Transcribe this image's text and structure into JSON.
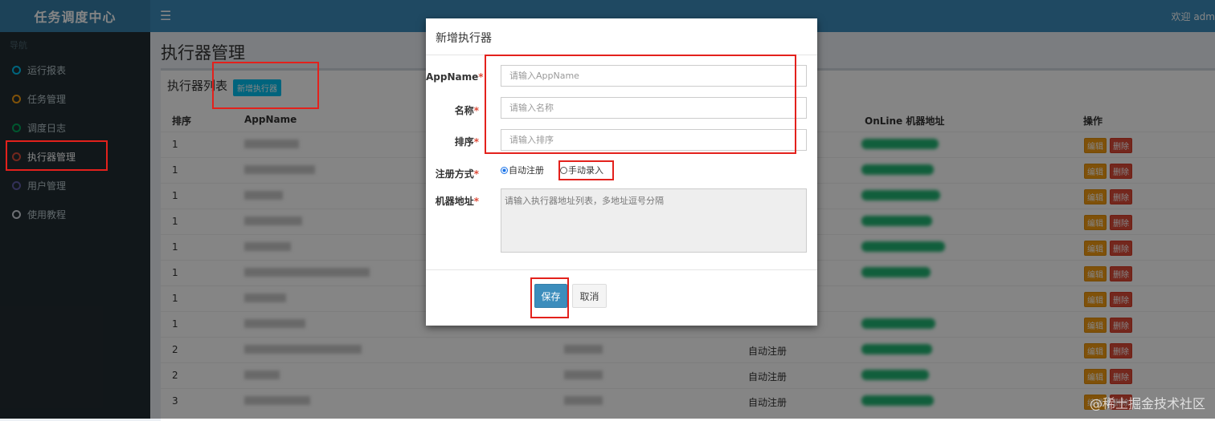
{
  "app": {
    "logo": "任务调度中心",
    "welcome": "欢迎 adm"
  },
  "sidebar": {
    "header": "导航",
    "items": [
      {
        "label": "运行报表",
        "color": "#00c0ef"
      },
      {
        "label": "任务管理",
        "color": "#f39c12"
      },
      {
        "label": "调度日志",
        "color": "#00a65a"
      },
      {
        "label": "执行器管理",
        "color": "#dd4b39"
      },
      {
        "label": "用户管理",
        "color": "#605ca8"
      },
      {
        "label": "使用教程",
        "color": "#d2d6de"
      }
    ]
  },
  "page": {
    "title": "执行器管理"
  },
  "box": {
    "title": "执行器列表",
    "add_button": "新增执行器",
    "columns": [
      "排序",
      "AppName",
      "OnLine 机器地址",
      "操作"
    ],
    "edit_label": "编辑",
    "delete_label": "删除",
    "rows": [
      {
        "order": "1",
        "reg": ""
      },
      {
        "order": "1",
        "reg": ""
      },
      {
        "order": "1",
        "reg": ""
      },
      {
        "order": "1",
        "reg": ""
      },
      {
        "order": "1",
        "reg": ""
      },
      {
        "order": "1",
        "reg": ""
      },
      {
        "order": "1",
        "reg": ""
      },
      {
        "order": "1",
        "reg": ""
      },
      {
        "order": "2",
        "reg": "自动注册"
      },
      {
        "order": "2",
        "reg": "自动注册"
      },
      {
        "order": "3",
        "reg": "自动注册"
      }
    ]
  },
  "modal": {
    "title": "新增执行器",
    "fields": {
      "appname": {
        "label": "AppName",
        "placeholder": "请输入AppName"
      },
      "name": {
        "label": "名称",
        "placeholder": "请输入名称"
      },
      "order": {
        "label": "排序",
        "placeholder": "请输入排序"
      },
      "reg_type": {
        "label": "注册方式",
        "option_auto": "自动注册",
        "option_manual": "手动录入"
      },
      "address": {
        "label": "机器地址",
        "placeholder": "请输入执行器地址列表，多地址逗号分隔"
      }
    },
    "save": "保存",
    "cancel": "取消"
  },
  "watermark": "@稀土掘金技术社区"
}
